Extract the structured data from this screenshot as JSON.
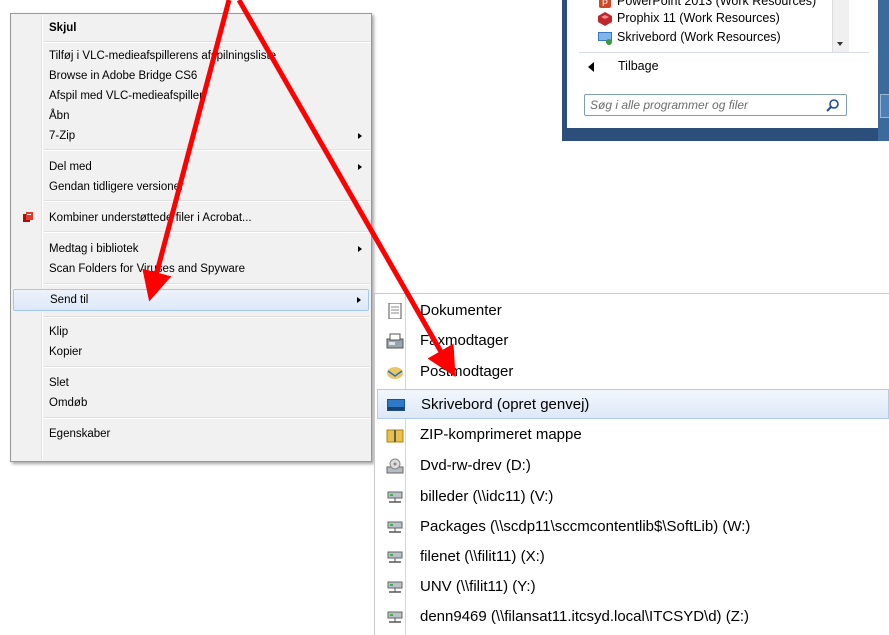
{
  "context_menu": {
    "items": [
      {
        "label": "Skjul",
        "bold": true,
        "submenu": false
      },
      {
        "label": "Tilføj i VLC-medieafspillerens afspilningsliste",
        "submenu": false
      },
      {
        "label": "Browse in Adobe Bridge CS6",
        "submenu": false
      },
      {
        "label": "Afspil med VLC-medieafspiller",
        "submenu": false
      },
      {
        "label": "Åbn",
        "submenu": false
      },
      {
        "label": "7-Zip",
        "submenu": true
      },
      {
        "label": "Del med",
        "submenu": true
      },
      {
        "label": "Gendan tidligere versioner",
        "submenu": false
      },
      {
        "label": "Kombiner understøttede filer i Acrobat...",
        "submenu": false,
        "icon": "acrobat-icon"
      },
      {
        "label": "Medtag i bibliotek",
        "submenu": true
      },
      {
        "label": "Scan Folders for Viruses and Spyware",
        "submenu": false
      },
      {
        "label": "Send til",
        "submenu": true,
        "highlighted": true
      },
      {
        "label": "Klip",
        "submenu": false
      },
      {
        "label": "Kopier",
        "submenu": false
      },
      {
        "label": "Slet",
        "submenu": false
      },
      {
        "label": "Omdøb",
        "submenu": false
      },
      {
        "label": "Egenskaber",
        "submenu": false
      }
    ]
  },
  "send_to_menu": {
    "items": [
      {
        "label": "Dokumenter",
        "icon": "documents-icon"
      },
      {
        "label": "Faxmodtager",
        "icon": "fax-icon"
      },
      {
        "label": "Postmodtager",
        "icon": "mail-icon"
      },
      {
        "label": "Skrivebord (opret genvej)",
        "icon": "desktop-icon",
        "highlighted": true
      },
      {
        "label": "ZIP-komprimeret mappe",
        "icon": "zip-folder-icon"
      },
      {
        "label": "Dvd-rw-drev (D:)",
        "icon": "dvd-drive-icon"
      },
      {
        "label": "billeder (\\\\idc11) (V:)",
        "icon": "network-drive-icon"
      },
      {
        "label": "Packages (\\\\scdp11\\sccmcontentlib$\\SoftLib) (W:)",
        "icon": "network-drive-icon"
      },
      {
        "label": "filenet (\\\\filit11) (X:)",
        "icon": "network-drive-icon"
      },
      {
        "label": "UNV (\\\\filit11) (Y:)",
        "icon": "network-drive-icon"
      },
      {
        "label": "denn9469 (\\\\filansat11.itcsyd.local\\ITCSYD\\d) (Z:)",
        "icon": "network-drive-icon"
      }
    ]
  },
  "start_menu": {
    "programs": [
      {
        "label": "PowerPoint 2013 (Work Resources)",
        "icon": "powerpoint-icon"
      },
      {
        "label": "Prophix 11 (Work Resources)",
        "icon": "prophix-icon"
      },
      {
        "label": "Skrivebord (Work Resources)",
        "icon": "desktop-icon"
      }
    ],
    "back_label": "Tilbage",
    "search_placeholder": "Søg i alle programmer og filer"
  },
  "colors": {
    "annotation_arrow": "#ff0000",
    "highlight_border": "#a8c6ec",
    "start_menu_frame": "#2b4f7a"
  }
}
